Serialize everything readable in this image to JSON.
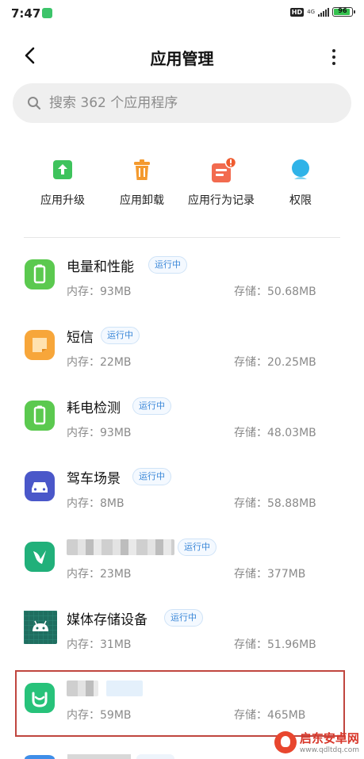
{
  "status_bar": {
    "time": "7:47",
    "hd": "HD",
    "network": "4G",
    "battery": "96"
  },
  "header": {
    "title": "应用管理"
  },
  "search": {
    "placeholder": "搜索 362 个应用程序"
  },
  "quick_actions": [
    {
      "label": "应用升级",
      "icon": "app-upgrade-icon",
      "color": "#3ec35c"
    },
    {
      "label": "应用卸载",
      "icon": "trash-icon",
      "color": "#f49a2e"
    },
    {
      "label": "应用行为记录",
      "icon": "behavior-record-icon",
      "color": "#f26b4f"
    },
    {
      "label": "权限",
      "icon": "permission-icon",
      "color": "#2fb3e8"
    }
  ],
  "apps": [
    {
      "name": "电量和性能",
      "badge": "运行中",
      "memory": "内存：93MB",
      "storage": "存储：50.68MB",
      "icon_color": "#5bc94f"
    },
    {
      "name": "短信",
      "badge": "运行中",
      "memory": "内存：22MB",
      "storage": "存储：20.25MB",
      "icon_color": "#f7a63a"
    },
    {
      "name": "耗电检测",
      "badge": "运行中",
      "memory": "内存：93MB",
      "storage": "存储：48.03MB",
      "icon_color": "#5bc94f"
    },
    {
      "name": "驾车场景",
      "badge": "运行中",
      "memory": "内存：8MB",
      "storage": "存储：58.88MB",
      "icon_color": "#4a57c9"
    },
    {
      "name": "",
      "badge": "运行中",
      "memory": "内存：23MB",
      "storage": "存储：377MB",
      "icon_color": "#21b07a"
    },
    {
      "name": "媒体存储设备",
      "badge": "运行中",
      "memory": "内存：31MB",
      "storage": "存储：51.96MB",
      "icon_color": "#1f6e60"
    },
    {
      "name": "",
      "badge": "",
      "memory": "内存：59MB",
      "storage": "存储：465MB",
      "icon_color": "#27c27a"
    }
  ],
  "watermark": {
    "name": "启东安卓网",
    "url": "www.qdltdq.com"
  }
}
